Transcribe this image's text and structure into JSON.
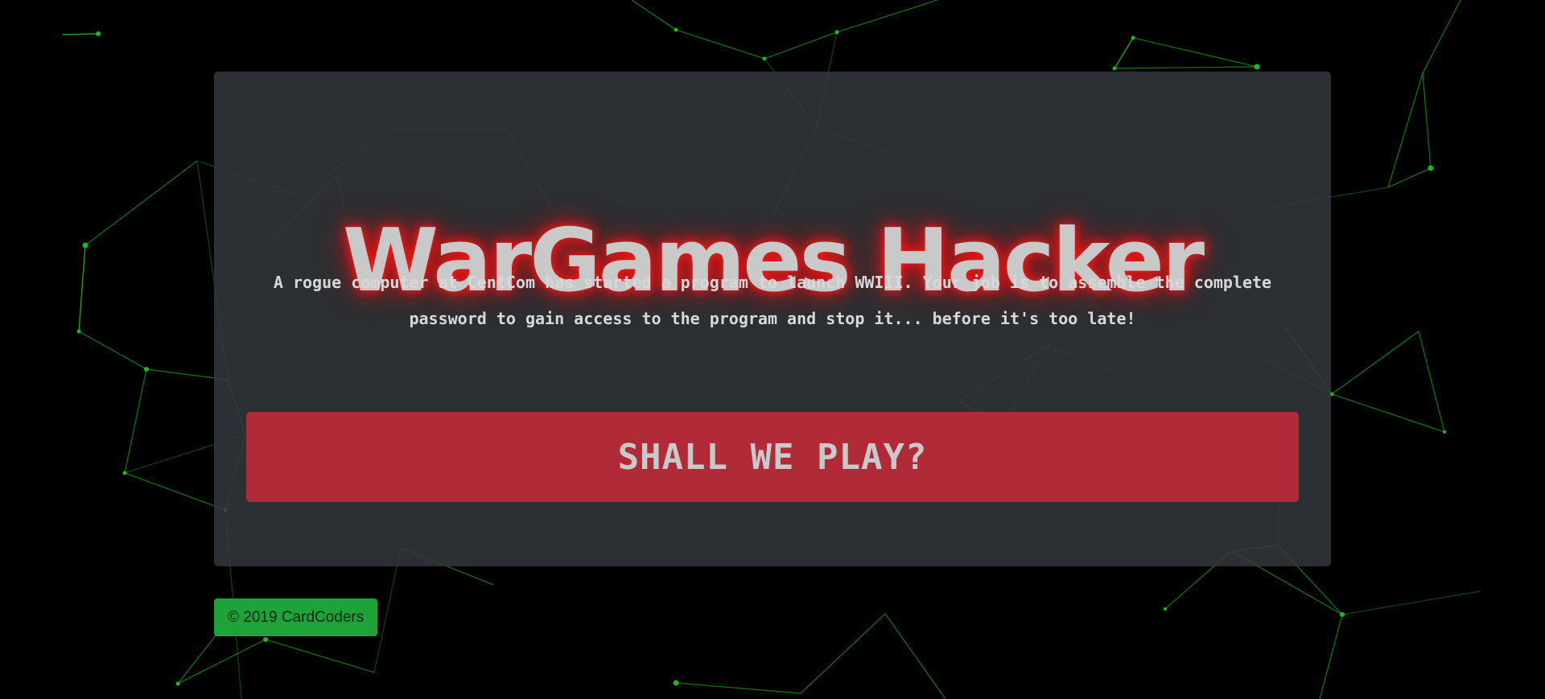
{
  "hero": {
    "title": "WarGames Hacker",
    "intro": "A rogue computer at CentCom has started a program to launch WWIII. Your job is to assemble the complete password to gain access to the program and stop it... before it's too late!",
    "button_label": "SHALL WE PLAY?"
  },
  "footer": {
    "copyright": "© 2019 CardCoders"
  },
  "colors": {
    "background": "#000000",
    "card": "#34383d",
    "title_glow": "#ff1a1a",
    "button": "#b02a37",
    "footer_badge": "#1fa23a",
    "network_lines": "#22b022"
  }
}
